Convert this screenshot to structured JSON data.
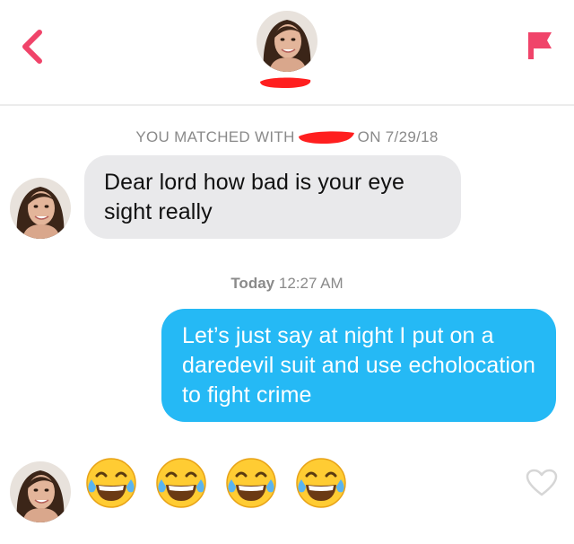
{
  "header": {
    "back_icon": "chevron-left-icon",
    "flag_icon": "flag-icon",
    "accent_color": "#f0446a"
  },
  "match_banner": {
    "prefix": "YOU MATCHED WITH",
    "suffix": "ON 7/29/18"
  },
  "messages": [
    {
      "direction": "received",
      "text": "Dear lord how bad is your eye sight really"
    },
    {
      "direction": "sent",
      "text": "Let’s just say at night I put on a daredevil suit and use echolocation to fight crime"
    },
    {
      "direction": "received",
      "text": "😂😂😂😂"
    }
  ],
  "timestamp": {
    "day": "Today",
    "time": "12:27 AM"
  },
  "colors": {
    "sent_bubble": "#25b9f5",
    "received_bubble": "#e9e9eb",
    "redaction": "#ff1f1f"
  },
  "icons": {
    "emoji": "tears-of-joy-emoji",
    "like": "heart-outline-icon"
  }
}
